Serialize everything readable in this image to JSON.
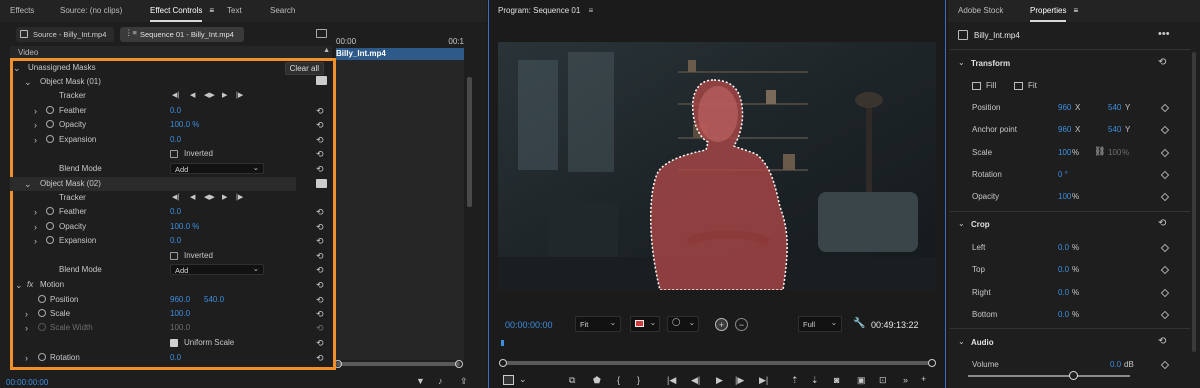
{
  "left_tabs": [
    "Effects",
    "Source: (no clips)",
    "Effect Controls",
    "Text",
    "Search"
  ],
  "source_chip": "Source - Billy_Int.mp4",
  "sequence_chip": "Sequence 01 - Billy_Int.mp4",
  "video_label": "Video",
  "timeline_time_start": "00:00",
  "timeline_time_end": "00:1",
  "clip_name": "Billy_Int.mp4",
  "unassigned_masks": "Unassigned Masks",
  "clear_all": "Clear all",
  "mask1": {
    "title": "Object Mask (01)",
    "tracker": "Tracker",
    "feather_label": "Feather",
    "feather_value": "0.0",
    "opacity_label": "Opacity",
    "opacity_value": "100.0 %",
    "expansion_label": "Expansion",
    "expansion_value": "0.0",
    "inverted": "Inverted",
    "blend_label": "Blend Mode",
    "blend_value": "Add"
  },
  "mask2": {
    "title": "Object Mask (02)",
    "tracker": "Tracker",
    "feather_label": "Feather",
    "feather_value": "0.0",
    "opacity_label": "Opacity",
    "opacity_value": "100.0 %",
    "expansion_label": "Expansion",
    "expansion_value": "0.0",
    "inverted": "Inverted",
    "blend_label": "Blend Mode",
    "blend_value": "Add"
  },
  "motion": {
    "fx": "fx",
    "title": "Motion",
    "position_label": "Position",
    "position_x": "960.0",
    "position_y": "540.0",
    "scale_label": "Scale",
    "scale_value": "100.0",
    "scale_width_label": "Scale Width",
    "scale_width_value": "100.0",
    "uniform_scale": "Uniform Scale",
    "rotation_label": "Rotation",
    "rotation_value": "0.0"
  },
  "left_timecode": "00:00:00:00",
  "program": {
    "title": "Program: Sequence 01",
    "timecode_left": "00:00:00:00",
    "fit": "Fit",
    "full": "Full",
    "timecode_right": "00:49:13:22"
  },
  "right_tabs": [
    "Adobe Stock",
    "Properties"
  ],
  "props": {
    "clip": "Billy_Int.mp4",
    "transform": "Transform",
    "fill": "Fill",
    "fit": "Fit",
    "position_label": "Position",
    "position_x": "960",
    "position_x_unit": "X",
    "position_y": "540",
    "position_y_unit": "Y",
    "anchor_label": "Anchor point",
    "anchor_x": "960",
    "anchor_x_unit": "X",
    "anchor_y": "540",
    "anchor_y_unit": "Y",
    "scale_label": "Scale",
    "scale_value": "100",
    "scale_unit": "%",
    "scale2_value": "100",
    "scale2_unit": "%",
    "rotation_label": "Rotation",
    "rotation_value": "0 °",
    "opacity_label": "Opacity",
    "opacity_value": "100",
    "opacity_unit": "%",
    "crop": "Crop",
    "left_label": "Left",
    "left_value": "0.0",
    "left_unit": "%",
    "top_label": "Top",
    "top_value": "0.0",
    "top_unit": "%",
    "right_label": "Right",
    "right_value": "0.0",
    "right_unit": "%",
    "bottom_label": "Bottom",
    "bottom_value": "0.0",
    "bottom_unit": "%",
    "audio": "Audio",
    "volume_label": "Volume",
    "volume_value": "0.0",
    "volume_unit": "dB"
  },
  "colors": {
    "accent_blue": "#3d8fe0",
    "highlight_orange": "#f2902a",
    "mask_red": "#b04848"
  }
}
